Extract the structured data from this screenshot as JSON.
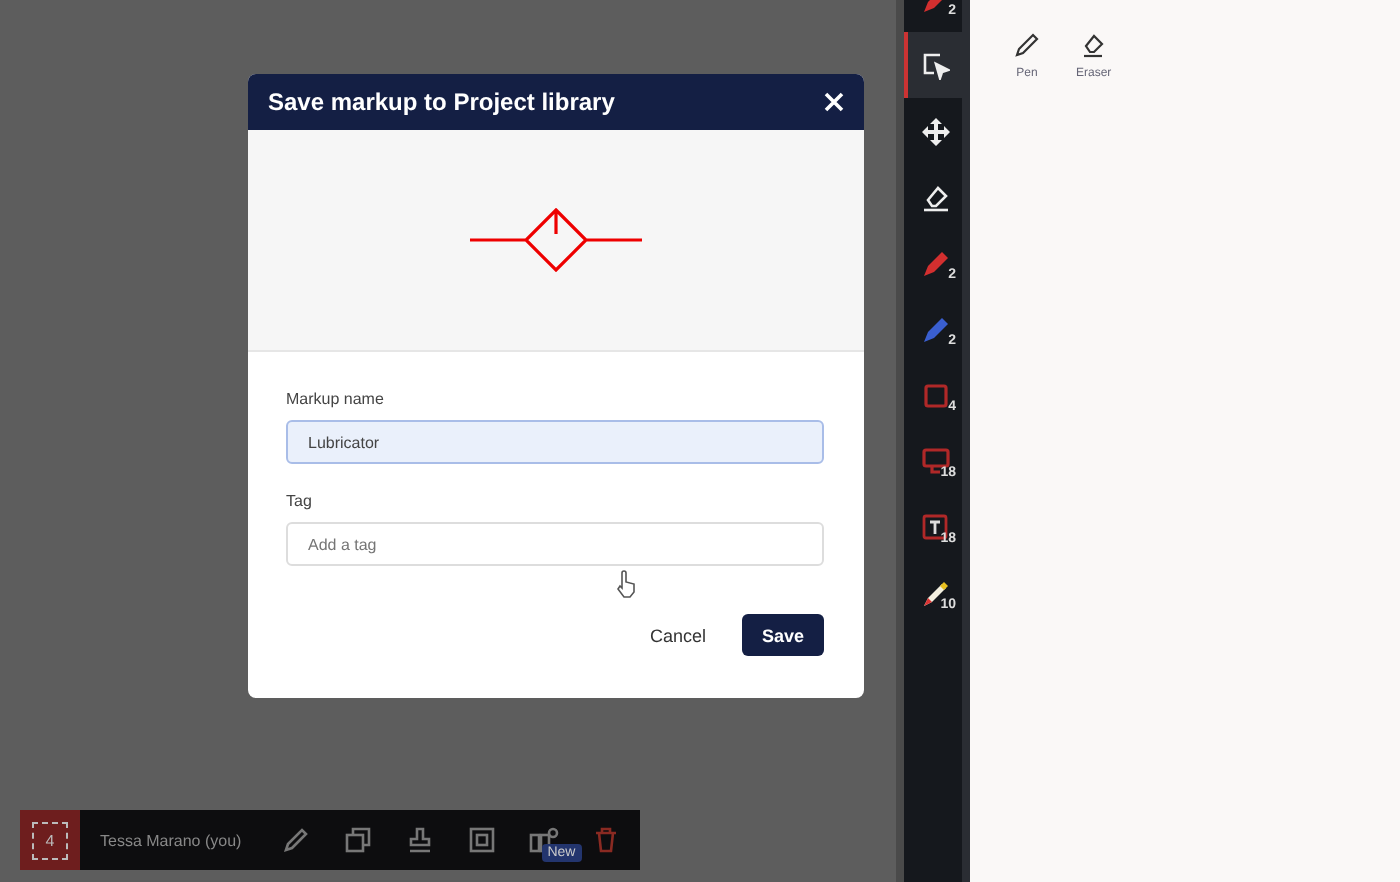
{
  "dialog": {
    "title": "Save markup to Project library",
    "name_field": {
      "label": "Markup name",
      "value": "Lubricator"
    },
    "tag_field": {
      "label": "Tag",
      "placeholder": "Add a tag"
    },
    "buttons": [
      {
        "label": "Cancel",
        "kind": "secondary"
      },
      {
        "label": "Save",
        "kind": "primary"
      }
    ]
  },
  "bottom_bar": {
    "page": "4",
    "user": "Tessa Marano (you)",
    "tools": [
      {
        "kind": "pencil"
      },
      {
        "kind": "copy"
      },
      {
        "kind": "stamp"
      },
      {
        "kind": "capture"
      },
      {
        "kind": "library",
        "badge": "New"
      },
      {
        "kind": "trash"
      }
    ]
  },
  "toolbar": {
    "items": [
      {
        "kind": "pen",
        "color": "#d32f2f",
        "count": "2",
        "selected": false
      },
      {
        "kind": "select",
        "selected": true
      },
      {
        "kind": "move",
        "selected": false
      },
      {
        "kind": "eraser",
        "selected": false
      },
      {
        "kind": "pen",
        "color": "#d32f2f",
        "count": "2",
        "selected": false
      },
      {
        "kind": "pen",
        "color": "#3a5fd0",
        "count": "2",
        "selected": false
      },
      {
        "kind": "square",
        "count": "4",
        "selected": false
      },
      {
        "kind": "callout",
        "count": "18",
        "selected": false
      },
      {
        "kind": "text",
        "count": "18",
        "selected": false
      },
      {
        "kind": "highlighter",
        "count": "10",
        "selected": false
      }
    ]
  },
  "panel": {
    "tools": [
      {
        "label": "Pen",
        "kind": "pen"
      },
      {
        "label": "Eraser",
        "kind": "eraser"
      }
    ]
  }
}
